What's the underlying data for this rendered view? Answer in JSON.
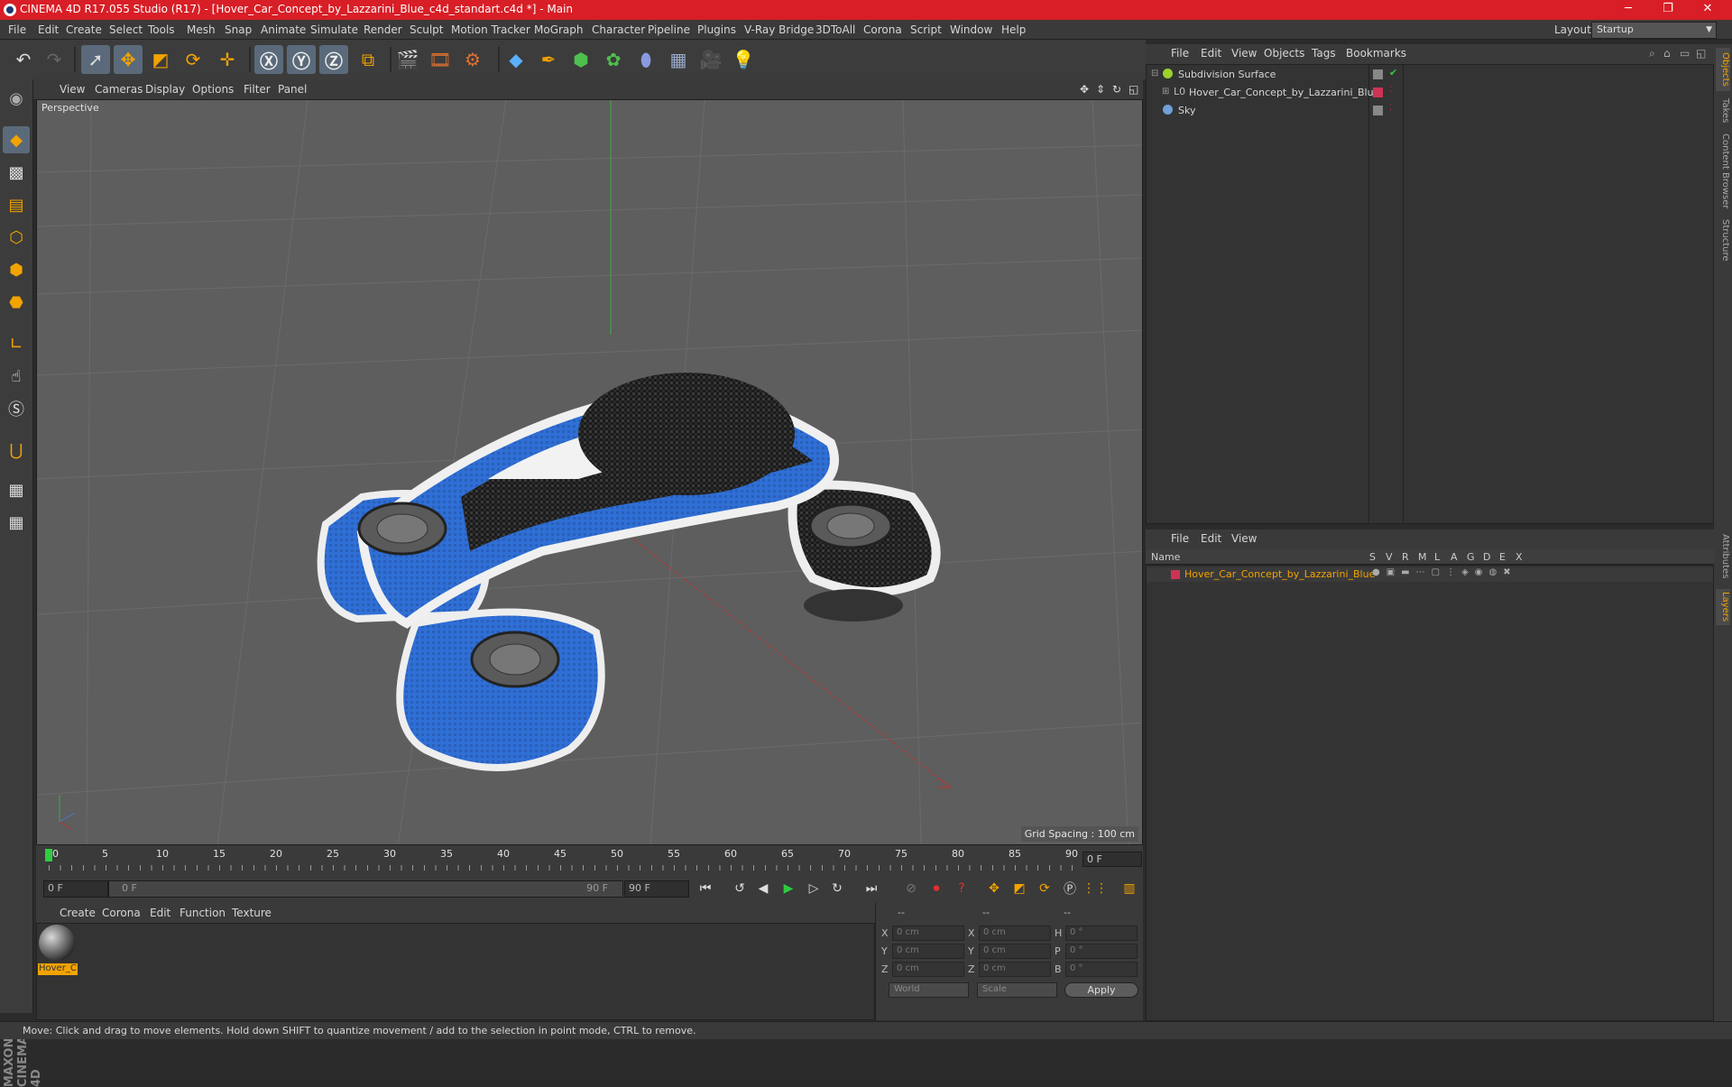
{
  "title_bar": {
    "title": "CINEMA 4D R17.055 Studio (R17) - [Hover_Car_Concept_by_Lazzarini_Blue_c4d_standart.c4d *] - Main",
    "minimize": "─",
    "restore": "❐",
    "close": "✕"
  },
  "menu": {
    "items": [
      "File",
      "Edit",
      "Create",
      "Select",
      "Tools",
      "Mesh",
      "Snap",
      "Animate",
      "Simulate",
      "Render",
      "Sculpt",
      "Motion Tracker",
      "MoGraph",
      "Character",
      "Pipeline",
      "Plugins",
      "V-Ray Bridge",
      "3DToAll",
      "Corona",
      "Script",
      "Window",
      "Help"
    ],
    "layout_label": "Layout:",
    "layout_value": "Startup"
  },
  "viewport": {
    "menu": [
      "View",
      "Cameras",
      "Display",
      "Options",
      "Filter",
      "Panel"
    ],
    "label": "Perspective",
    "grid_spacing": "Grid Spacing : 100 cm"
  },
  "timeline": {
    "labels": [
      "0",
      "5",
      "10",
      "15",
      "20",
      "25",
      "30",
      "35",
      "40",
      "45",
      "50",
      "55",
      "60",
      "65",
      "70",
      "75",
      "80",
      "85",
      "90"
    ],
    "current_frame": "0 F",
    "start_field": "0 F",
    "range_left": "0 F",
    "range_right": "90 F",
    "end_field": "90 F"
  },
  "materials": {
    "menu": [
      "Create",
      "Corona",
      "Edit",
      "Function",
      "Texture"
    ],
    "items": [
      {
        "name": "Hover_C"
      }
    ]
  },
  "coordinates": {
    "header": [
      "--",
      "--",
      "--"
    ],
    "rows": [
      {
        "a": "X",
        "av": "0 cm",
        "b": "X",
        "bv": "0 cm",
        "c": "H",
        "cv": "0 °"
      },
      {
        "a": "Y",
        "av": "0 cm",
        "b": "Y",
        "bv": "0 cm",
        "c": "P",
        "cv": "0 °"
      },
      {
        "a": "Z",
        "av": "0 cm",
        "b": "Z",
        "bv": "0 cm",
        "c": "B",
        "cv": "0 °"
      }
    ],
    "mode": "World",
    "scale": "Scale",
    "apply": "Apply"
  },
  "objects": {
    "menu": [
      "File",
      "Edit",
      "View",
      "Objects",
      "Tags",
      "Bookmarks"
    ],
    "items": [
      {
        "name": "Subdivision Surface",
        "color": "#9ad12d"
      },
      {
        "name": "Hover_Car_Concept_by_Lazzarini_Blue",
        "color": "#9aa6b2"
      },
      {
        "name": "Sky",
        "color": "#6fa0d8"
      }
    ]
  },
  "layers": {
    "menu": [
      "File",
      "Edit",
      "View"
    ],
    "columns": [
      "Name",
      "S",
      "V",
      "R",
      "M",
      "L",
      "A",
      "G",
      "D",
      "E",
      "X"
    ],
    "items": [
      {
        "name": "Hover_Car_Concept_by_Lazzarini_Blue",
        "color": "#cc3355"
      }
    ]
  },
  "side_tabs": [
    "Objects",
    "Takes",
    "Content Browser",
    "Structure",
    "Attributes",
    "Layers"
  ],
  "status": "Move: Click and drag to move elements. Hold down SHIFT to quantize movement / add to the selection in point mode, CTRL to remove.",
  "brand": "MAXON CINEMA 4D",
  "colors": {
    "accent": "#f2a300",
    "title_bar": "#d81e26",
    "car_blue": "#2f6fd6"
  }
}
